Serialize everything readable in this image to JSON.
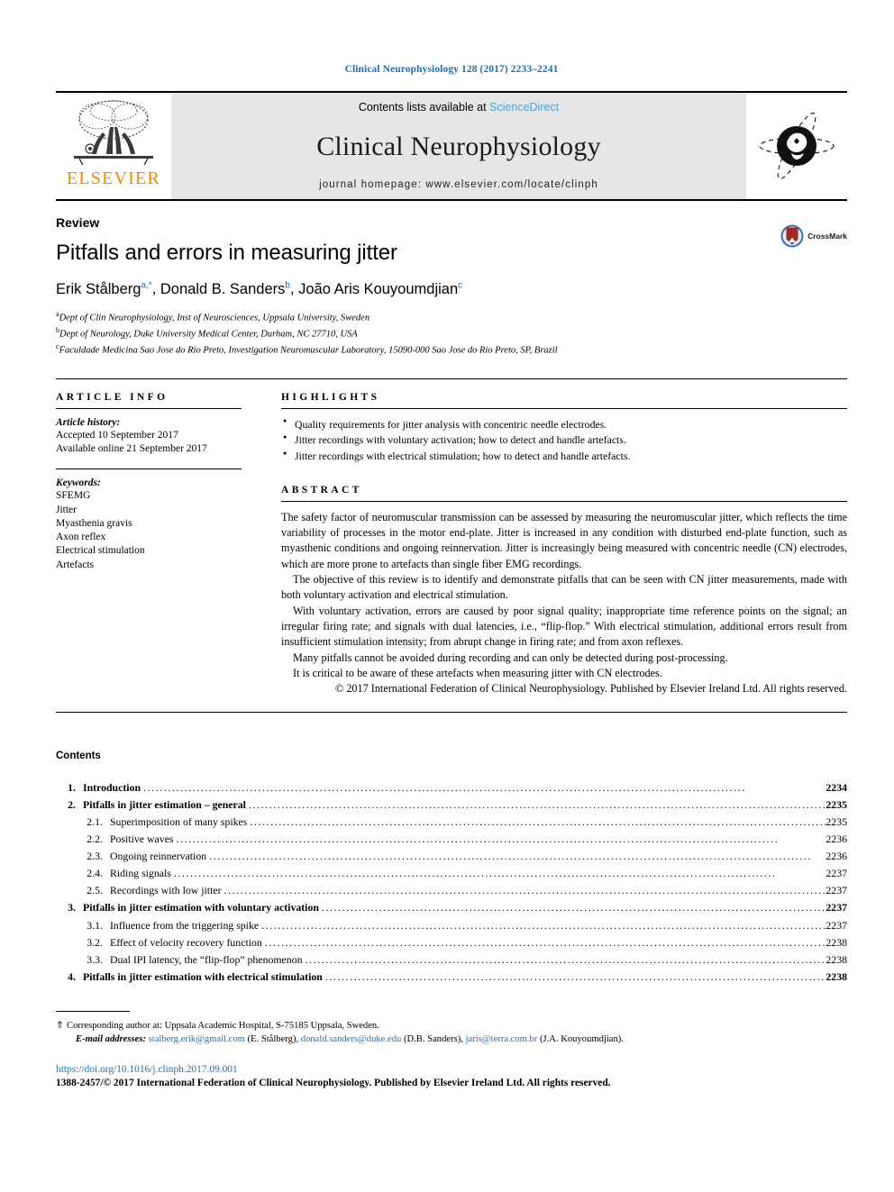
{
  "running_head": "Clinical Neurophysiology 128 (2017) 2233–2241",
  "masthead": {
    "contents_prefix": "Contents lists available at ",
    "sciencedirect": "ScienceDirect",
    "journal_name": "Clinical Neurophysiology",
    "homepage": "journal homepage: www.elsevier.com/locate/clinph",
    "elsevier_word": "ELSEVIER",
    "accent_link": "#4aa3df"
  },
  "title_block": {
    "doc_type": "Review",
    "title": "Pitfalls and errors in measuring jitter",
    "crossmark_label": "CrossMark",
    "authors": [
      {
        "name": "Erik Stålberg",
        "marks": "a,*"
      },
      {
        "name": "Donald B. Sanders",
        "marks": "b"
      },
      {
        "name": "João Aris Kouyoumdjian",
        "marks": "c"
      }
    ],
    "affiliations": [
      {
        "mark": "a",
        "text": "Dept of Clin Neurophysiology, Inst of Neurosciences, Uppsala University, Sweden"
      },
      {
        "mark": "b",
        "text": "Dept of Neurology, Duke University Medical Center, Durham, NC 27710, USA"
      },
      {
        "mark": "c",
        "text": "Faculdade Medicina Sao Jose do Rio Preto, Investigation Neuromuscular Laboratory, 15090-000 Sao Jose do Rio Preto, SP, Brazil"
      }
    ]
  },
  "article_info": {
    "heading": "ARTICLE INFO",
    "history_label": "Article history:",
    "history": [
      "Accepted 10 September 2017",
      "Available online 21 September 2017"
    ],
    "keywords_label": "Keywords:",
    "keywords": [
      "SFEMG",
      "Jitter",
      "Myasthenia gravis",
      "Axon reflex",
      "Electrical stimulation",
      "Artefacts"
    ]
  },
  "highlights": {
    "heading": "HIGHLIGHTS",
    "items": [
      "Quality requirements for jitter analysis with concentric needle electrodes.",
      "Jitter recordings with voluntary activation; how to detect and handle artefacts.",
      "Jitter recordings with electrical stimulation; how to detect and handle artefacts."
    ]
  },
  "abstract": {
    "heading": "ABSTRACT",
    "paragraphs": [
      "The safety factor of neuromuscular transmission can be assessed by measuring the neuromuscular jitter, which reflects the time variability of processes in the motor end-plate. Jitter is increased in any condition with disturbed end-plate function, such as myasthenic conditions and ongoing reinnervation. Jitter is increasingly being measured with concentric needle (CN) electrodes, which are more prone to artefacts than single fiber EMG recordings.",
      "The objective of this review is to identify and demonstrate pitfalls that can be seen with CN jitter measurements, made with both voluntary activation and electrical stimulation.",
      "With voluntary activation, errors are caused by poor signal quality; inappropriate time reference points on the signal; an irregular firing rate; and signals with dual latencies, i.e., “flip-flop.” With electrical stimulation, additional errors result from insufficient stimulation intensity; from abrupt change in firing rate; and from axon reflexes.",
      "Many pitfalls cannot be avoided during recording and can only be detected during post-processing.",
      "It is critical to be aware of these artefacts when measuring jitter with CN electrodes."
    ],
    "copyright": "© 2017 International Federation of Clinical Neurophysiology. Published by Elsevier Ireland Ltd. All rights reserved."
  },
  "contents": {
    "title": "Contents",
    "entries": [
      {
        "level": 1,
        "num": "1.",
        "label": "Introduction",
        "page": "2234"
      },
      {
        "level": 1,
        "num": "2.",
        "label": "Pitfalls in jitter estimation – general",
        "page": "2235"
      },
      {
        "level": 2,
        "num": "2.1.",
        "label": "Superimposition of many spikes",
        "page": "2235"
      },
      {
        "level": 2,
        "num": "2.2.",
        "label": "Positive waves",
        "page": "2236"
      },
      {
        "level": 2,
        "num": "2.3.",
        "label": "Ongoing reinnervation",
        "page": "2236"
      },
      {
        "level": 2,
        "num": "2.4.",
        "label": "Riding signals",
        "page": "2237"
      },
      {
        "level": 2,
        "num": "2.5.",
        "label": "Recordings with low jitter",
        "page": "2237"
      },
      {
        "level": 1,
        "num": "3.",
        "label": "Pitfalls in jitter estimation with voluntary activation",
        "page": "2237"
      },
      {
        "level": 2,
        "num": "3.1.",
        "label": "Influence from the triggering spike",
        "page": "2237"
      },
      {
        "level": 2,
        "num": "3.2.",
        "label": "Effect of velocity recovery function",
        "page": "2238"
      },
      {
        "level": 2,
        "num": "3.3.",
        "label": "Dual IPI latency, the “flip-flop” phenomenon",
        "page": "2238"
      },
      {
        "level": 1,
        "num": "4.",
        "label": "Pitfalls in jitter estimation with electrical stimulation",
        "page": "2238"
      }
    ]
  },
  "footer": {
    "corresponding_star": "⇑",
    "corresponding_text": "Corresponding author at: Uppsala Academic Hospital, S-75185 Uppsala, Sweden.",
    "emails_label": "E-mail addresses:",
    "emails": [
      {
        "address": "stalberg.erik@gmail.com",
        "owner": "(E. Stålberg)"
      },
      {
        "address": "donald.sanders@duke.edu",
        "owner": "(D.B. Sanders)"
      },
      {
        "address": "jaris@terra.com.br",
        "owner": "(J.A. Kouyoumdjian)"
      }
    ],
    "doi": "https://doi.org/10.1016/j.clinph.2017.09.001",
    "issn_line": "1388-2457/© 2017 International Federation of Clinical Neurophysiology. Published by Elsevier Ireland Ltd. All rights reserved."
  }
}
